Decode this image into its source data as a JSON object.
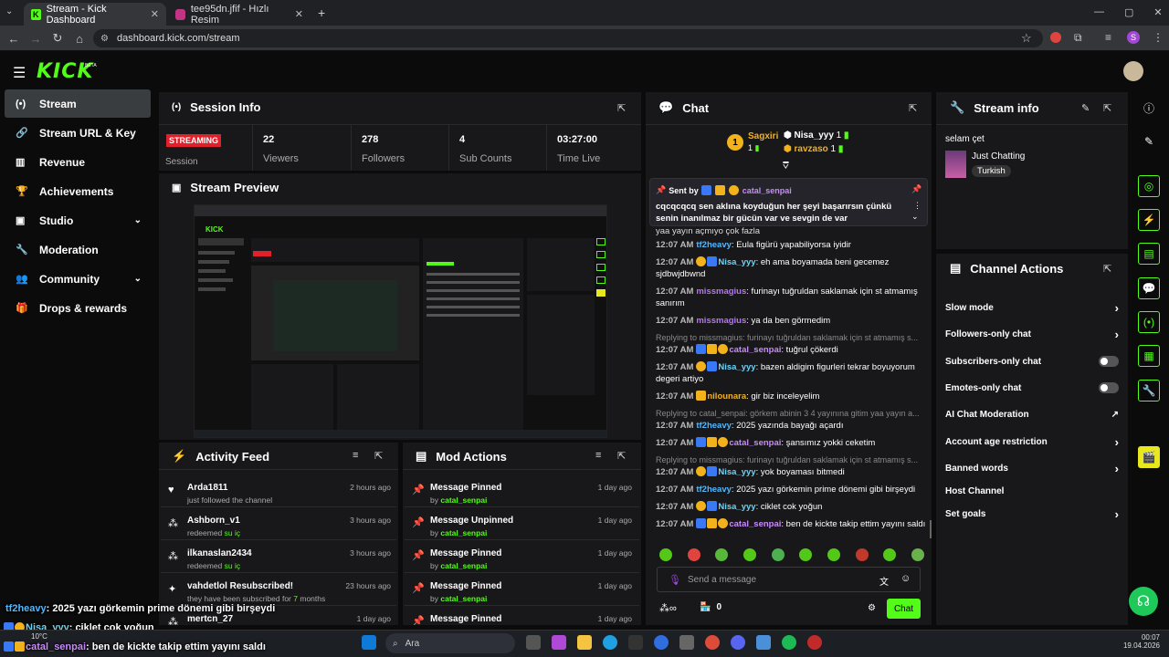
{
  "browser": {
    "tabs": [
      {
        "title": "Stream - Kick Dashboard"
      },
      {
        "title": "tee95dn.jfif - Hızlı Resim"
      }
    ],
    "url": "dashboard.kick.com/stream"
  },
  "app": {
    "logo": "KICK",
    "beta": "BETA"
  },
  "sidebar": {
    "items": [
      {
        "label": "Stream",
        "icon": "radio-icon"
      },
      {
        "label": "Stream URL & Key",
        "icon": "link-icon"
      },
      {
        "label": "Revenue",
        "icon": "chart-icon"
      },
      {
        "label": "Achievements",
        "icon": "trophy-icon"
      },
      {
        "label": "Studio",
        "icon": "studio-icon"
      },
      {
        "label": "Moderation",
        "icon": "wrench-icon"
      },
      {
        "label": "Community",
        "icon": "users-icon"
      },
      {
        "label": "Drops & rewards",
        "icon": "gift-icon"
      }
    ]
  },
  "session": {
    "title": "Session Info",
    "status": "STREAMING",
    "status_label": "Session",
    "stats": [
      {
        "value": "22",
        "label": "Viewers"
      },
      {
        "value": "278",
        "label": "Followers"
      },
      {
        "value": "4",
        "label": "Sub Counts"
      },
      {
        "value": "03:27:00",
        "label": "Time Live"
      }
    ]
  },
  "preview": {
    "title": "Stream Preview"
  },
  "activity": {
    "title": "Activity Feed",
    "items": [
      {
        "name": "Arda1811",
        "detail": "just followed the channel",
        "time": "2 hours ago"
      },
      {
        "name": "Ashborn_v1",
        "detail": "redeemed",
        "extra": "su iç",
        "time": "3 hours ago"
      },
      {
        "name": "ilkanaslan2434",
        "detail": "redeemed",
        "extra": "su iç",
        "time": "3 hours ago"
      },
      {
        "name": "vahdetlol Resubscribed!",
        "detail": "they have been subscribed for",
        "extra": "7",
        "extra2": "months",
        "time": "23 hours ago"
      },
      {
        "name": "mertcn_27",
        "detail": "",
        "time": "1 day ago"
      }
    ]
  },
  "mod": {
    "title": "Mod Actions",
    "items": [
      {
        "action": "Message Pinned",
        "by": "by",
        "user": "catal_senpai",
        "time": "1 day ago"
      },
      {
        "action": "Message Unpinned",
        "by": "by",
        "user": "catal_senpai",
        "time": "1 day ago"
      },
      {
        "action": "Message Pinned",
        "by": "by",
        "user": "catal_senpai",
        "time": "1 day ago"
      },
      {
        "action": "Message Pinned",
        "by": "by",
        "user": "catal_senpai",
        "time": "1 day ago"
      },
      {
        "action": "Message Pinned",
        "by": "by",
        "user": "",
        "time": "1 day ago"
      }
    ]
  },
  "chat": {
    "title": "Chat",
    "top": {
      "first": "Sagxiri",
      "first_count": "1",
      "second": "Nisa_yyy",
      "second_count": "1",
      "third": "ravzaso",
      "third_count": "1"
    },
    "pinned": {
      "sent_by": "Sent by",
      "user": "catal_senpai",
      "text": "cqcqcqcq sen aklına koyduğun her şeyi başarırsın çünkü senin inanılmaz bir gücün var ve sevgin de var"
    },
    "behind": "yaa yayın açmıyo çok fazla",
    "messages": [
      {
        "time": "12:07 AM",
        "user": "tf2heavy",
        "color": "#53b7fc",
        "text": ": Eula figürü yapabiliyorsa iyidir"
      },
      {
        "time": "12:07 AM",
        "user": "Nisa_yyy",
        "color": "#6cd3f5",
        "text": ": eh ama boyamada beni gecemez sjdbwjdbwnd"
      },
      {
        "time": "12:07 AM",
        "user": "missmagius",
        "color": "#b874f5",
        "text": ": furinayı tuğruldan saklamak için st atmamış sanırım"
      },
      {
        "time": "12:07 AM",
        "user": "missmagius",
        "color": "#b874f5",
        "text": ": ya da ben görmedim"
      },
      {
        "time": "12:07 AM",
        "user": "catal_senpai",
        "color": "#c98bfa",
        "text": ": tuğrul çökerdi",
        "reply": "Replying to missmagius: furinayı tuğruldan saklamak için st atmamış s..."
      },
      {
        "time": "12:07 AM",
        "user": "Nisa_yyy",
        "color": "#6cd3f5",
        "text": ": bazen aldigim figurleri tekrar boyuyorum degeri artiyo"
      },
      {
        "time": "12:07 AM",
        "user": "nilounara",
        "color": "#f2b21c",
        "text": ": gir biz inceleyelim"
      },
      {
        "time": "12:07 AM",
        "user": "tf2heavy",
        "color": "#53b7fc",
        "text": ": 2025 yazında bayağı açardı",
        "reply": "Replying to catal_senpai: görkem abinin 3 4 yayınına gitim yaa yayın a..."
      },
      {
        "time": "12:07 AM",
        "user": "catal_senpai",
        "color": "#c98bfa",
        "text": ": şansımız yokki ceketim"
      },
      {
        "time": "12:07 AM",
        "user": "Nisa_yyy",
        "color": "#6cd3f5",
        "text": ": yok boyaması bitmedi",
        "reply": "Replying to missmagius: furinayı tuğruldan saklamak için st atmamış s..."
      },
      {
        "time": "12:07 AM",
        "user": "tf2heavy",
        "color": "#53b7fc",
        "text": ": 2025 yazı görkemin prime dönemi gibi birşeydi"
      },
      {
        "time": "12:07 AM",
        "user": "Nisa_yyy",
        "color": "#6cd3f5",
        "text": ": ciklet cok yoğun"
      },
      {
        "time": "12:07 AM",
        "user": "catal_senpai",
        "color": "#c98bfa",
        "text": ": ben de kickte takip ettim yayını saldı"
      }
    ],
    "input_placeholder": "Send a message",
    "count": "0",
    "send_label": "Chat"
  },
  "stream_info": {
    "title": "Stream info",
    "stream_title": "selam çet",
    "category": "Just Chatting",
    "tag": "Turkish"
  },
  "actions": {
    "title": "Channel Actions",
    "items": [
      {
        "label": "Slow mode",
        "kind": "chevron"
      },
      {
        "label": "Followers-only chat",
        "kind": "chevron"
      },
      {
        "label": "Subscribers-only chat",
        "kind": "toggle"
      },
      {
        "label": "Emotes-only chat",
        "kind": "toggle"
      },
      {
        "label": "AI Chat Moderation",
        "kind": "external"
      },
      {
        "label": "Account age restriction",
        "kind": "chevron"
      },
      {
        "label": "Banned words",
        "kind": "chevron"
      },
      {
        "label": "Host Channel",
        "kind": "none"
      },
      {
        "label": "Set goals",
        "kind": "chevron"
      }
    ]
  },
  "overlay": [
    {
      "user": "tf2heavy",
      "text": ": 2025 yazı görkemin prime dönemi gibi birşeydi"
    },
    {
      "user": "Nisa_yyy",
      "text": ": ciklet cok yoğun"
    },
    {
      "user": "catal_senpai",
      "text": ": ben de kickte takip ettim yayını saldı"
    }
  ],
  "taskbar": {
    "search": "Ara",
    "weather": "10°C",
    "time": "00:07",
    "date": "19.04.2026"
  }
}
